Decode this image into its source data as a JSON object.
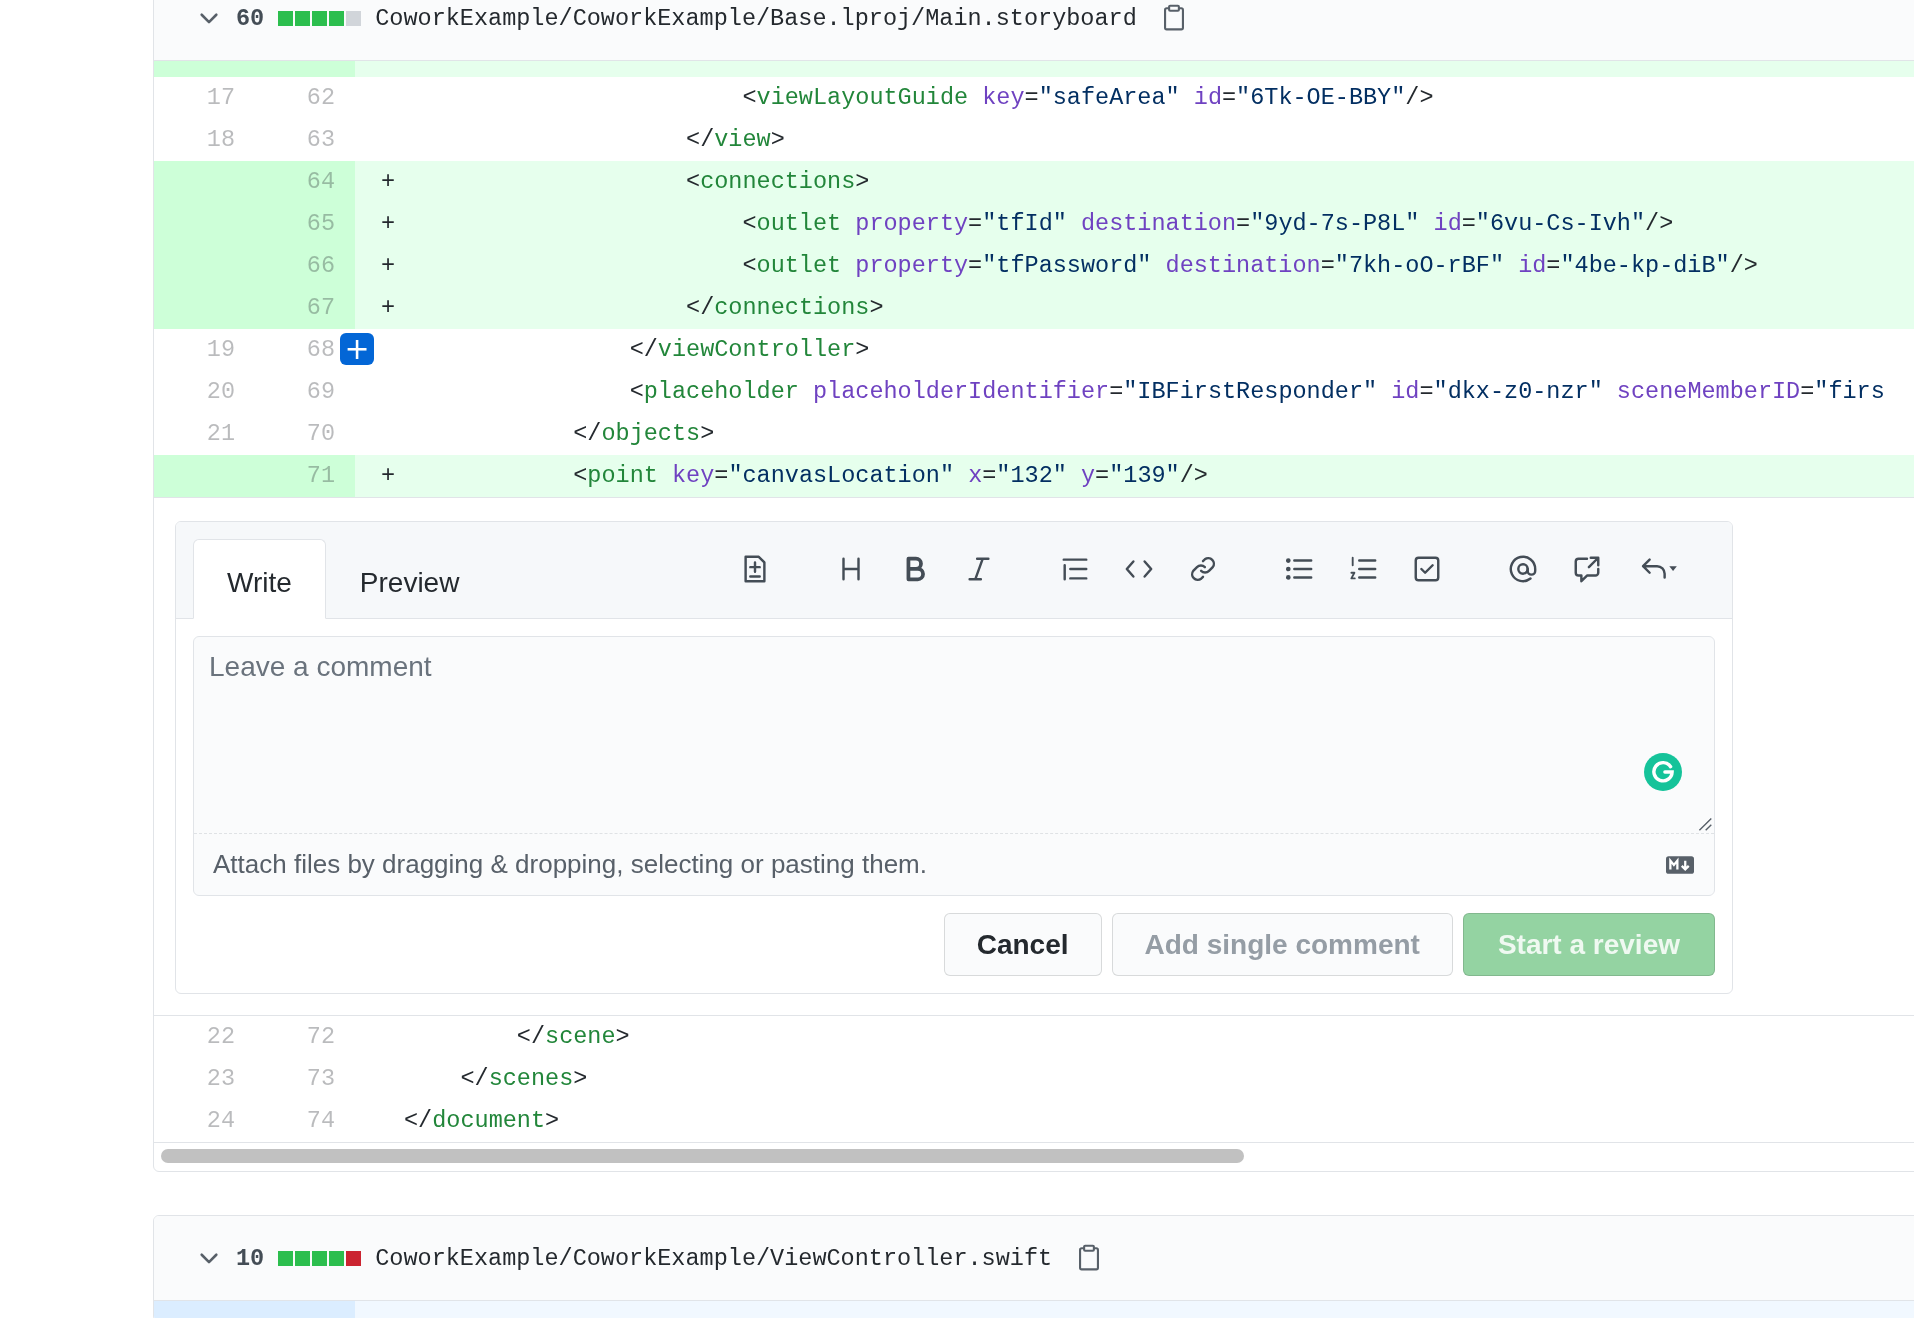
{
  "files": [
    {
      "expanded": true,
      "changes": "60",
      "diffstat": [
        {
          "color": "#2cbe4e"
        },
        {
          "color": "#2cbe4e"
        },
        {
          "color": "#2cbe4e"
        },
        {
          "color": "#2cbe4e"
        },
        {
          "color": "#d1d5da"
        }
      ],
      "path": "CoworkExample/CoworkExample/Base.lproj/Main.storyboard",
      "rows": [
        {
          "kind": "partial_added"
        },
        {
          "kind": "context",
          "old": "17",
          "new": "62",
          "tokens": [
            {
              "kind": "plain",
              "text": "                        <"
            },
            {
              "kind": "tag",
              "text": "viewLayoutGuide"
            },
            {
              "kind": "attr",
              "text": " key"
            },
            {
              "kind": "plain",
              "text": "="
            },
            {
              "kind": "string",
              "text": "\"safeArea\""
            },
            {
              "kind": "attr",
              "text": " id"
            },
            {
              "kind": "plain",
              "text": "="
            },
            {
              "kind": "string",
              "text": "\"6Tk-OE-BBY\""
            },
            {
              "kind": "plain",
              "text": "/>"
            }
          ]
        },
        {
          "kind": "context",
          "old": "18",
          "new": "63",
          "tokens": [
            {
              "kind": "plain",
              "text": "                    </"
            },
            {
              "kind": "tag",
              "text": "view"
            },
            {
              "kind": "plain",
              "text": ">"
            }
          ]
        },
        {
          "kind": "added",
          "new": "64",
          "marker": "+",
          "tokens": [
            {
              "kind": "plain",
              "text": "                    <"
            },
            {
              "kind": "tag",
              "text": "connections"
            },
            {
              "kind": "plain",
              "text": ">"
            }
          ]
        },
        {
          "kind": "added",
          "new": "65",
          "marker": "+",
          "tokens": [
            {
              "kind": "plain",
              "text": "                        <"
            },
            {
              "kind": "tag",
              "text": "outlet"
            },
            {
              "kind": "attr",
              "text": " property"
            },
            {
              "kind": "plain",
              "text": "="
            },
            {
              "kind": "string",
              "text": "\"tfId\""
            },
            {
              "kind": "attr",
              "text": " destination"
            },
            {
              "kind": "plain",
              "text": "="
            },
            {
              "kind": "string",
              "text": "\"9yd-7s-P8L\""
            },
            {
              "kind": "attr",
              "text": " id"
            },
            {
              "kind": "plain",
              "text": "="
            },
            {
              "kind": "string",
              "text": "\"6vu-Cs-Ivh\""
            },
            {
              "kind": "plain",
              "text": "/>"
            }
          ]
        },
        {
          "kind": "added",
          "new": "66",
          "marker": "+",
          "tokens": [
            {
              "kind": "plain",
              "text": "                        <"
            },
            {
              "kind": "tag",
              "text": "outlet"
            },
            {
              "kind": "attr",
              "text": " property"
            },
            {
              "kind": "plain",
              "text": "="
            },
            {
              "kind": "string",
              "text": "\"tfPassword\""
            },
            {
              "kind": "attr",
              "text": " destination"
            },
            {
              "kind": "plain",
              "text": "="
            },
            {
              "kind": "string",
              "text": "\"7kh-oO-rBF\""
            },
            {
              "kind": "attr",
              "text": " id"
            },
            {
              "kind": "plain",
              "text": "="
            },
            {
              "kind": "string",
              "text": "\"4be-kp-diB\""
            },
            {
              "kind": "plain",
              "text": "/>"
            }
          ]
        },
        {
          "kind": "added",
          "new": "67",
          "marker": "+",
          "tokens": [
            {
              "kind": "plain",
              "text": "                    </"
            },
            {
              "kind": "tag",
              "text": "connections"
            },
            {
              "kind": "plain",
              "text": ">"
            }
          ]
        },
        {
          "kind": "context",
          "old": "19",
          "new": "68",
          "hover_button": "+",
          "tokens": [
            {
              "kind": "plain",
              "text": "                </"
            },
            {
              "kind": "tag",
              "text": "viewController"
            },
            {
              "kind": "plain",
              "text": ">"
            }
          ]
        },
        {
          "kind": "context",
          "old": "20",
          "new": "69",
          "tokens": [
            {
              "kind": "plain",
              "text": "                <"
            },
            {
              "kind": "tag",
              "text": "placeholder"
            },
            {
              "kind": "attr",
              "text": " placeholderIdentifier"
            },
            {
              "kind": "plain",
              "text": "="
            },
            {
              "kind": "string",
              "text": "\"IBFirstResponder\""
            },
            {
              "kind": "attr",
              "text": " id"
            },
            {
              "kind": "plain",
              "text": "="
            },
            {
              "kind": "string",
              "text": "\"dkx-z0-nzr\""
            },
            {
              "kind": "attr",
              "text": " sceneMemberID"
            },
            {
              "kind": "plain",
              "text": "="
            },
            {
              "kind": "string",
              "text": "\"firs"
            }
          ]
        },
        {
          "kind": "context",
          "old": "21",
          "new": "70",
          "tokens": [
            {
              "kind": "plain",
              "text": "            </"
            },
            {
              "kind": "tag",
              "text": "objects"
            },
            {
              "kind": "plain",
              "text": ">"
            }
          ]
        },
        {
          "kind": "added",
          "new": "71",
          "marker": "+",
          "tokens": [
            {
              "kind": "plain",
              "text": "            <"
            },
            {
              "kind": "tag",
              "text": "point"
            },
            {
              "kind": "attr",
              "text": " key"
            },
            {
              "kind": "plain",
              "text": "="
            },
            {
              "kind": "string",
              "text": "\"canvasLocation\""
            },
            {
              "kind": "attr",
              "text": " x"
            },
            {
              "kind": "plain",
              "text": "="
            },
            {
              "kind": "string",
              "text": "\"132\""
            },
            {
              "kind": "attr",
              "text": " y"
            },
            {
              "kind": "plain",
              "text": "="
            },
            {
              "kind": "string",
              "text": "\"139\""
            },
            {
              "kind": "plain",
              "text": "/>"
            }
          ]
        },
        {
          "kind": "comment_form",
          "tabs": [
            {
              "label": "Write",
              "selected": true
            },
            {
              "label": "Preview",
              "selected": false
            }
          ],
          "comment": {
            "placeholder": "Leave a comment"
          },
          "attach_hint": "Attach files by dragging & dropping, selecting or pasting them.",
          "buttons": [
            {
              "label": "Cancel",
              "kind": "default",
              "disabled": false
            },
            {
              "label": "Add single comment",
              "kind": "default",
              "disabled": true
            },
            {
              "label": "Start a review",
              "kind": "primary",
              "disabled": true
            }
          ]
        },
        {
          "kind": "context",
          "old": "22",
          "new": "72",
          "tokens": [
            {
              "kind": "plain",
              "text": "        </"
            },
            {
              "kind": "tag",
              "text": "scene"
            },
            {
              "kind": "plain",
              "text": ">"
            }
          ]
        },
        {
          "kind": "context",
          "old": "23",
          "new": "73",
          "tokens": [
            {
              "kind": "plain",
              "text": "    </"
            },
            {
              "kind": "tag",
              "text": "scenes"
            },
            {
              "kind": "plain",
              "text": ">"
            }
          ]
        },
        {
          "kind": "context",
          "old": "24",
          "new": "74",
          "tokens": [
            {
              "kind": "plain",
              "text": "</"
            },
            {
              "kind": "tag",
              "text": "document"
            },
            {
              "kind": "plain",
              "text": ">"
            }
          ]
        },
        {
          "kind": "scrollbar"
        }
      ]
    },
    {
      "expanded": true,
      "changes": "10",
      "diffstat": [
        {
          "color": "#2cbe4e"
        },
        {
          "color": "#2cbe4e"
        },
        {
          "color": "#2cbe4e"
        },
        {
          "color": "#2cbe4e"
        },
        {
          "color": "#cb2431"
        }
      ],
      "path": "CoworkExample/CoworkExample/ViewController.swift",
      "rows": [
        {
          "kind": "hunk"
        }
      ]
    }
  ]
}
